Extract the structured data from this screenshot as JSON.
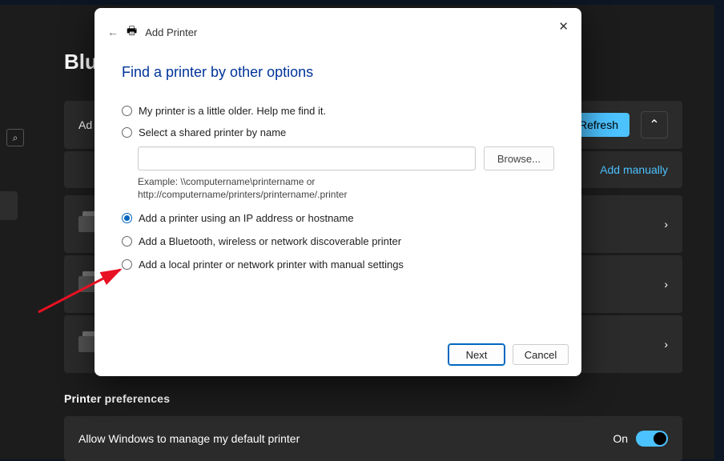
{
  "titlebar": {
    "minimize": "—",
    "maximize": "▢",
    "close": "✕"
  },
  "settings": {
    "page_title": "Blu",
    "search_icon": "⌕",
    "add_row_label": "Ad",
    "refresh_btn": "Refresh",
    "chevron_up": "⌃",
    "add_manually_link": "Add manually",
    "chevron_right": "›",
    "section_title": "Printer preferences",
    "pref": {
      "label": "Allow Windows to manage my default printer",
      "state_label": "On"
    }
  },
  "dialog": {
    "back": "←",
    "printer_glyph": "🖶",
    "title": "Add Printer",
    "close": "✕",
    "heading": "Find a printer by other options",
    "options": {
      "older": "My printer is a little older. Help me find it.",
      "shared": "Select a shared printer by name",
      "browse_btn": "Browse...",
      "example": "Example: \\\\computername\\printername or http://computername/printers/printername/.printer",
      "ip": "Add a printer using an IP address or hostname",
      "bt": "Add a Bluetooth, wireless or network discoverable printer",
      "local": "Add a local printer or network printer with manual settings"
    },
    "next_btn": "Next",
    "cancel_btn": "Cancel"
  }
}
